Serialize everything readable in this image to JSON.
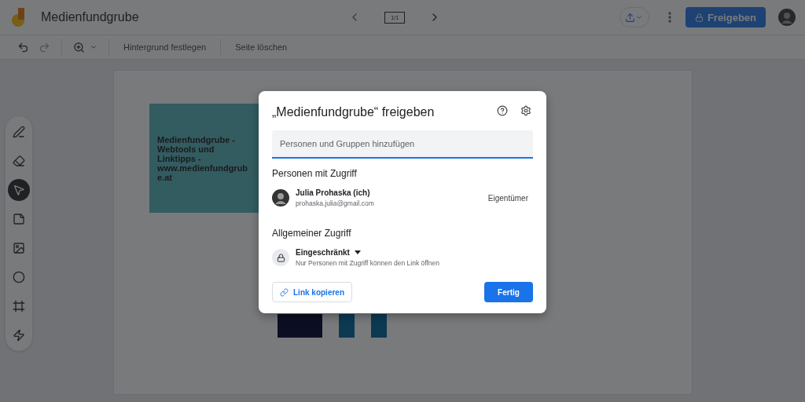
{
  "app": {
    "title": "Medienfundgrube",
    "slide_counter": "1/1",
    "share_button": "Freigeben"
  },
  "toolbar": {
    "background_button": "Hintergrund festlegen",
    "delete_page_button": "Seite löschen"
  },
  "tools": [
    {
      "kind": "pen",
      "selected": false
    },
    {
      "kind": "eraser",
      "selected": false
    },
    {
      "kind": "select",
      "selected": true
    },
    {
      "kind": "note",
      "selected": false
    },
    {
      "kind": "image",
      "selected": false
    },
    {
      "kind": "shape",
      "selected": false
    },
    {
      "kind": "textbox",
      "selected": false
    },
    {
      "kind": "laser",
      "selected": false
    }
  ],
  "canvas": {
    "sticky_note": "Medienfundgrube - Webtools und Linktipps - www.medienfundgrube.at",
    "shapes": [
      {
        "color": "#0c0f24"
      },
      {
        "color": "#0b3a52"
      },
      {
        "color": "#0b3a52"
      }
    ]
  },
  "dialog": {
    "title": "„Medienfundgrube“ freigeben",
    "search": {
      "placeholder": "Personen und Gruppen hinzufügen"
    },
    "people_heading": "Personen mit Zugriff",
    "people": [
      {
        "name": "Julia Prohaska (ich)",
        "email": "prohaska.julia@gmail.com",
        "role": "Eigentümer"
      }
    ],
    "general_heading": "Allgemeiner Zugriff",
    "access": {
      "label": "Eingeschränkt",
      "description": "Nur Personen mit Zugriff können den Link öffnen"
    },
    "copy_link_button": "Link kopieren",
    "done_button": "Fertig"
  }
}
